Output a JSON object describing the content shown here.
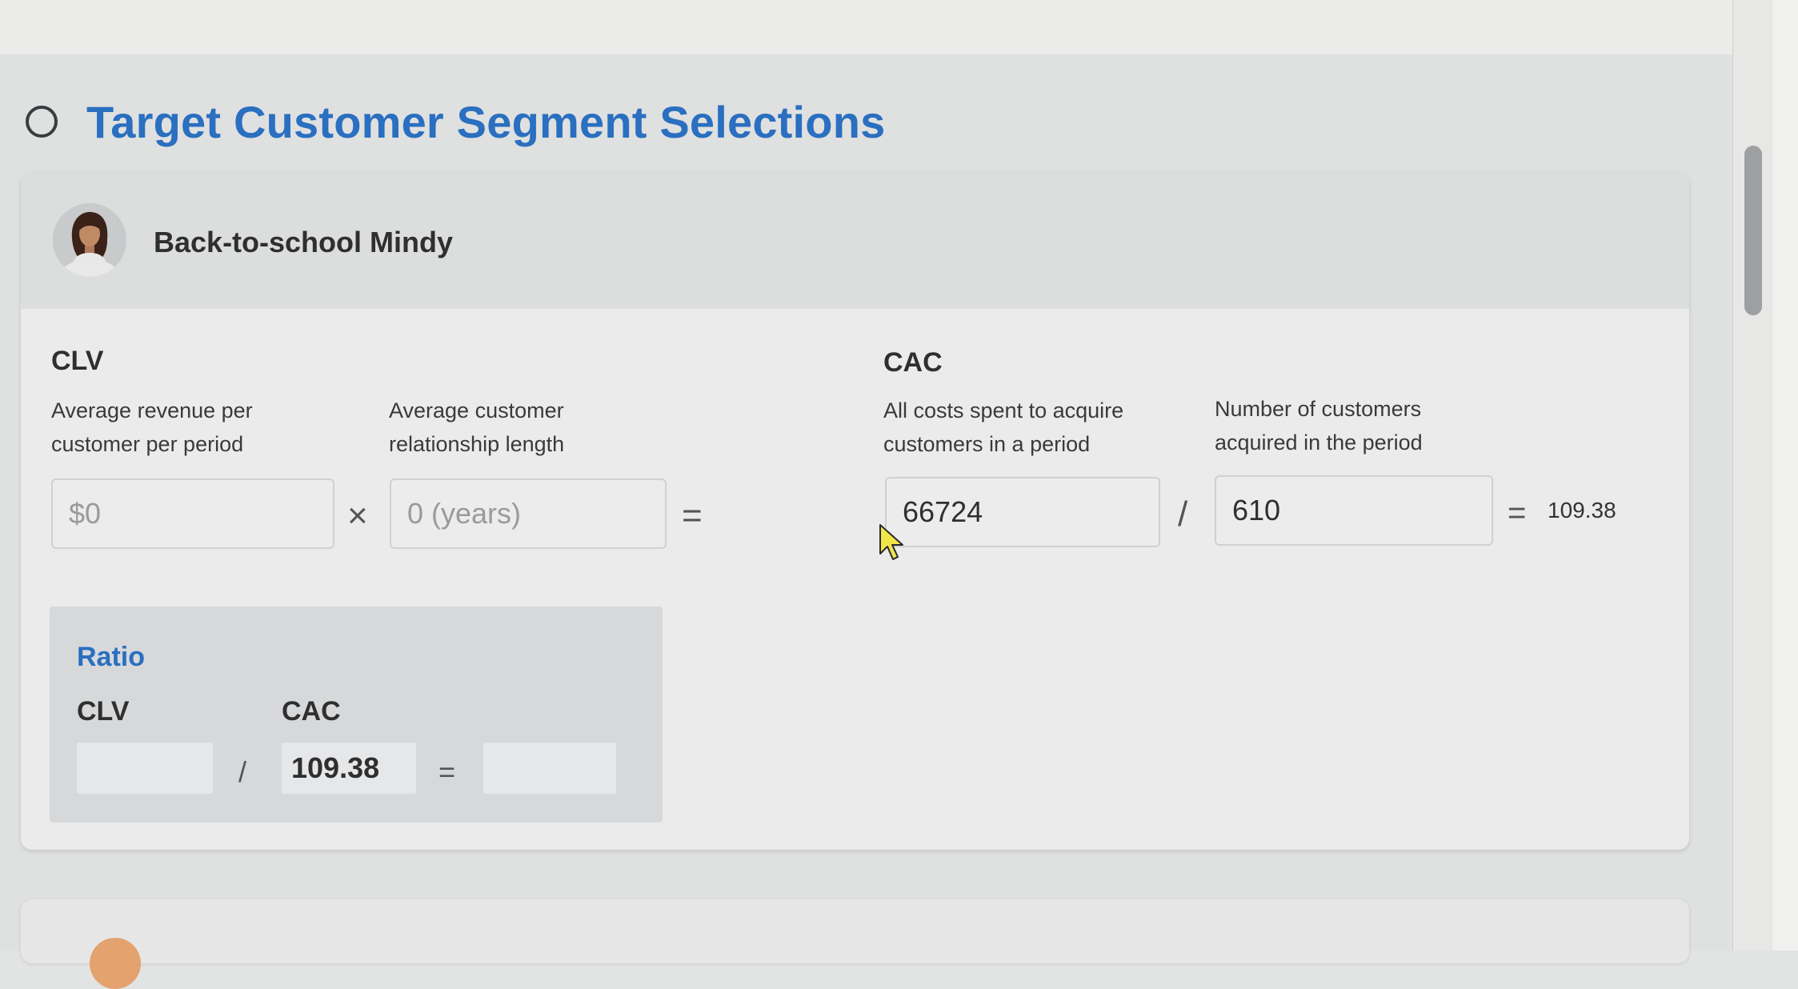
{
  "section": {
    "title": "Target Customer Segment Selections"
  },
  "persona": {
    "name": "Back-to-school Mindy"
  },
  "clv": {
    "heading": "CLV",
    "revenue_label": "Average revenue per customer per period",
    "revenue_placeholder": "$0",
    "times_symbol": "×",
    "length_label": "Average customer relationship length",
    "length_placeholder": "0 (years)",
    "equals_symbol": "="
  },
  "cac": {
    "heading": "CAC",
    "costs_label": "All costs spent to acquire customers in a period",
    "costs_value": "66724",
    "divide_symbol": "/",
    "customers_label": "Number of customers acquired in the period",
    "customers_value": "610",
    "equals_symbol": "=",
    "result": "109.38"
  },
  "ratio": {
    "title": "Ratio",
    "clv_label": "CLV",
    "cac_label": "CAC",
    "clv_value": "",
    "divide_symbol": "/",
    "cac_value": "109.38",
    "equals_symbol": "=",
    "result_value": ""
  },
  "icons": {
    "section": "circle-outline-icon",
    "avatar": "woman-avatar-icon",
    "cursor": "mouse-pointer-icon"
  },
  "colors": {
    "accent": "#2a6fc0",
    "next_avatar": "#e3a26e"
  }
}
